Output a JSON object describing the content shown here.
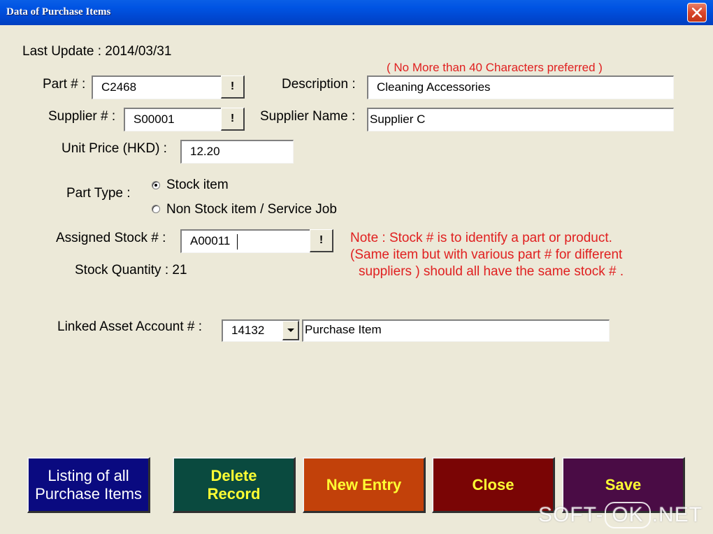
{
  "window": {
    "title": "Data of Purchase Items",
    "close_icon": "close-x-icon"
  },
  "last_update": "Last Update : 2014/03/31",
  "hint": "( No More than 40 Characters preferred )",
  "part": {
    "label": "Part # :",
    "value": "C2468",
    "lookup_label": "!"
  },
  "description": {
    "label": "Description :",
    "value": "Cleaning Accessories"
  },
  "supplier": {
    "label": "Supplier # :",
    "value": "S00001",
    "lookup_label": "!"
  },
  "supplier_name": {
    "label": "Supplier Name :",
    "value": "Supplier C"
  },
  "unit_price": {
    "label": "Unit Price (HKD) :",
    "value": "12.20"
  },
  "part_type": {
    "label": "Part Type :",
    "options": [
      "Stock item",
      "Non Stock item / Service Job"
    ],
    "selected": "Stock item"
  },
  "assigned_stock": {
    "label": "Assigned Stock # :",
    "value": "A00011",
    "lookup_label": "!"
  },
  "note": {
    "line1": "Note : Stock # is to identify a part or product.",
    "line2": "(Same item but with various part # for different",
    "line3": "suppliers ) should all have the same stock # ."
  },
  "stock_quantity": "Stock Quantity : 21",
  "linked_account": {
    "label": "Linked Asset Account # :",
    "value": "14132",
    "name": "Purchase Item"
  },
  "buttons": {
    "listing_line1": "Listing of all",
    "listing_line2": "Purchase Items",
    "delete_line1": "Delete",
    "delete_line2": "Record",
    "new_entry": "New Entry",
    "close": "Close",
    "save": "Save"
  },
  "colors": {
    "listing": "#0a0a80",
    "delete": "#0a4a3f",
    "new_entry": "#c2410a",
    "close": "#7a0505",
    "save": "#4a0c45"
  },
  "watermark": {
    "left": "SOFT-",
    "middle": "OK",
    "right": ".NET"
  }
}
